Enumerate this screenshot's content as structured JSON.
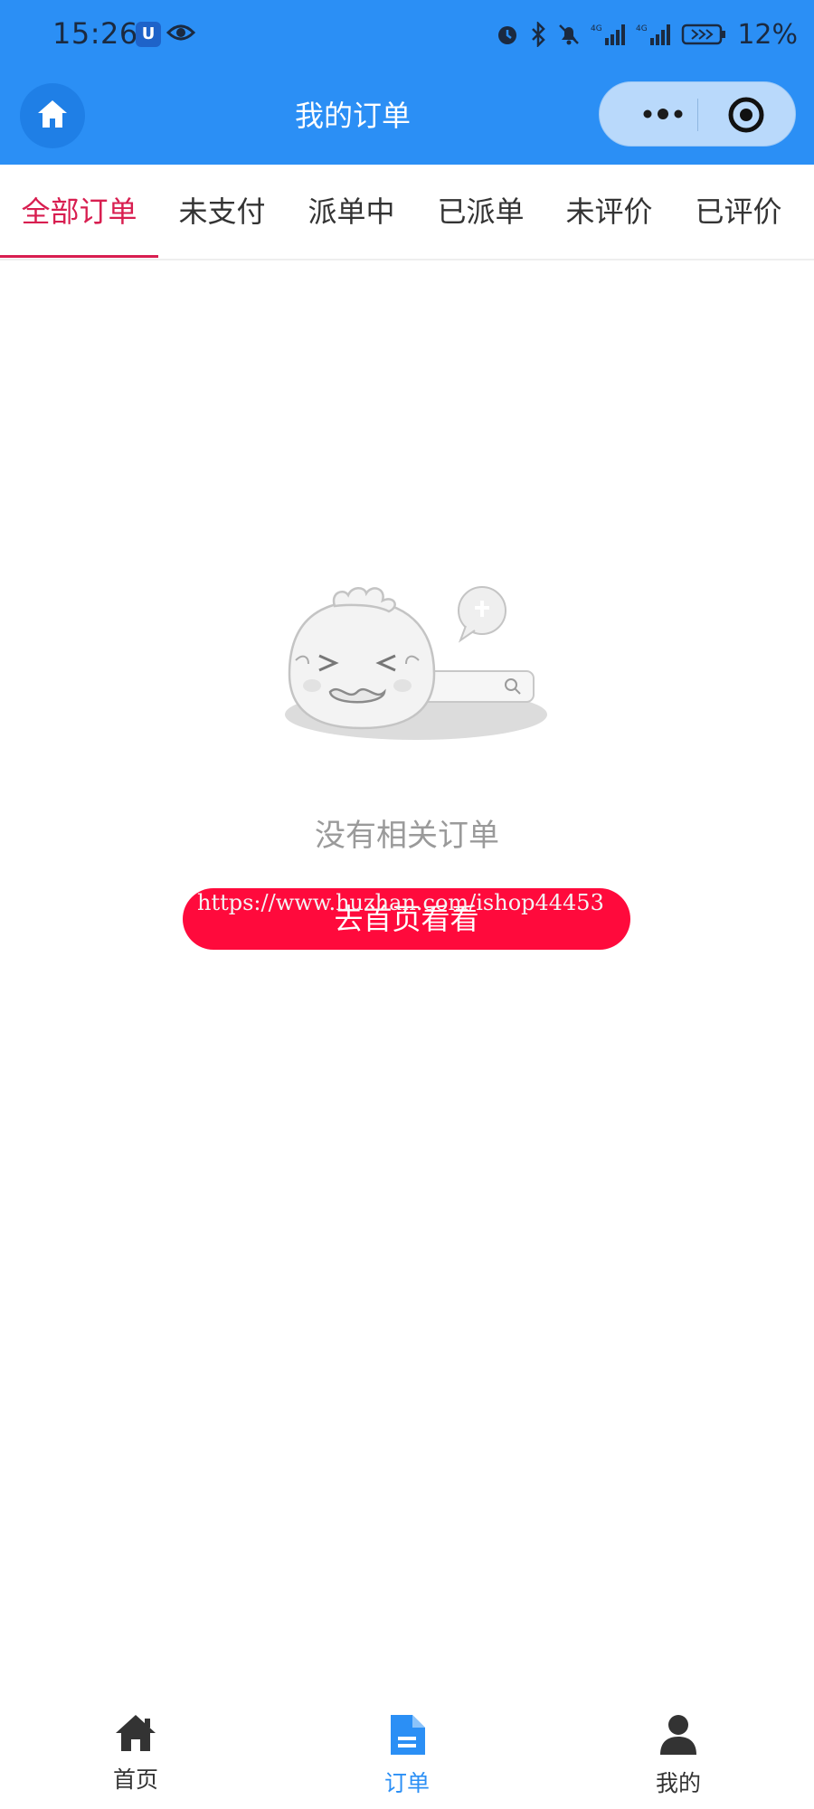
{
  "status_bar": {
    "time": "15:26",
    "battery": "12%",
    "app_badge": "U",
    "icons": [
      "eye-icon",
      "alarm-icon",
      "bluetooth-icon",
      "mute-icon",
      "signal-4g-icon",
      "signal-4g-icon",
      "battery-icon"
    ]
  },
  "header": {
    "title": "我的订单",
    "home_icon": "home-icon",
    "capsule_icons": [
      "more-dots-icon",
      "target-icon"
    ]
  },
  "tabs": [
    {
      "label": "全部订单",
      "active": true
    },
    {
      "label": "未支付",
      "active": false
    },
    {
      "label": "派单中",
      "active": false
    },
    {
      "label": "已派单",
      "active": false
    },
    {
      "label": "未评价",
      "active": false
    },
    {
      "label": "已评价",
      "active": false
    }
  ],
  "empty_state": {
    "message": "没有相关订单",
    "button_label": "去首页看看",
    "watermark": "https://www.huzhan.com/ishop44453"
  },
  "bottom_nav": [
    {
      "label": "首页",
      "icon": "home-icon",
      "active": false
    },
    {
      "label": "订单",
      "icon": "document-icon",
      "active": true
    },
    {
      "label": "我的",
      "icon": "user-icon",
      "active": false
    }
  ],
  "colors": {
    "header_bg": "#2b8ff5",
    "tab_active": "#d81e50",
    "button_bg": "#ff0a3c",
    "nav_active": "#2b8ff5",
    "empty_text": "#9a9a9a"
  }
}
